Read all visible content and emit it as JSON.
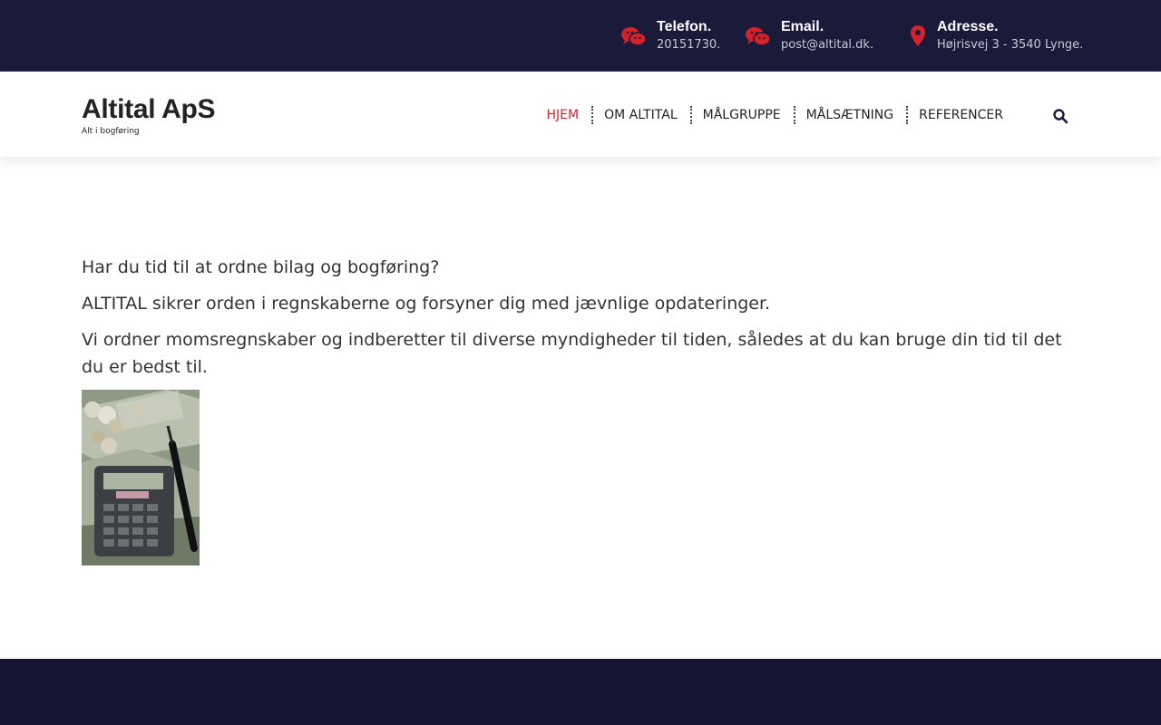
{
  "topbar": {
    "phone": {
      "label": "Telefon.",
      "value": "20151730.",
      "icon": "chat-bubbles-icon"
    },
    "email": {
      "label": "Email.",
      "value": "post@altital.dk.",
      "icon": "chat-bubbles-icon"
    },
    "address": {
      "label": "Adresse.",
      "value": "Højrisvej 3 - 3540 Lynge.",
      "icon": "map-pin-icon"
    }
  },
  "brand": {
    "title": "Altital ApS",
    "tagline": "Alt i bogføring"
  },
  "nav": {
    "items": [
      {
        "label": "HJEM",
        "active": true
      },
      {
        "label": "OM ALTITAL",
        "active": false
      },
      {
        "label": "MÅLGRUPPE",
        "active": false
      },
      {
        "label": "MÅLSÆTNING",
        "active": false
      },
      {
        "label": "REFERENCER",
        "active": false
      }
    ],
    "search_icon": "search-icon"
  },
  "content": {
    "paragraphs": [
      "Har du tid til at ordne bilag og bogføring?",
      "ALTITAL sikrer orden i regnskaberne og forsyner dig med jævnlige opdateringer.",
      "Vi ordner momsregnskaber og indberetter til diverse myndigheder til tiden, således at du kan bruge din tid til det du er bedst til."
    ],
    "image": "calculator-money-pen-photo"
  },
  "colors": {
    "topbar_bg": "#1b1a3a",
    "footer_bg": "#151533",
    "accent": "#d2232a",
    "text": "#333333"
  }
}
